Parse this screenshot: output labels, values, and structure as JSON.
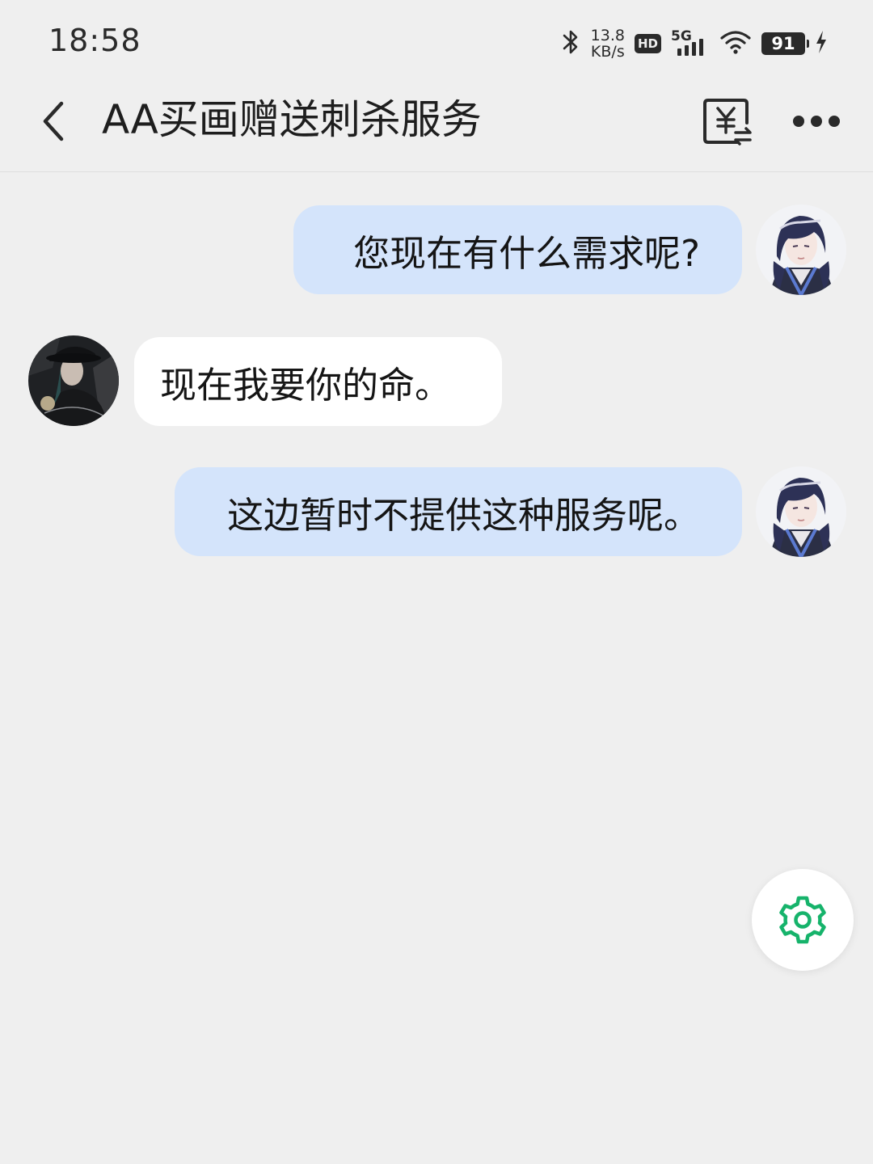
{
  "status_bar": {
    "time": "18:58",
    "net_speed_value": "13.8",
    "net_speed_unit": "KB/s",
    "hd_label": "HD",
    "network_label": "5G",
    "battery_level": "91",
    "icons": [
      "bluetooth-icon",
      "signal-icon",
      "wifi-icon",
      "battery-icon",
      "charging-icon"
    ]
  },
  "header": {
    "title": "AA买画赠送刺杀服务",
    "icons": [
      "back-chevron-icon",
      "yuan-transfer-icon",
      "more-dots-icon"
    ]
  },
  "messages": [
    {
      "sender": "me",
      "text": "您现在有什么需求呢?"
    },
    {
      "sender": "other",
      "text": "现在我要你的命。"
    },
    {
      "sender": "me",
      "text": "这边暂时不提供这种服务呢。"
    }
  ],
  "fab": {
    "icon": "gear-icon",
    "color": "#16b36b"
  },
  "colors": {
    "background": "#efefef",
    "my_bubble": "#d4e4fb",
    "other_bubble": "#ffffff"
  }
}
